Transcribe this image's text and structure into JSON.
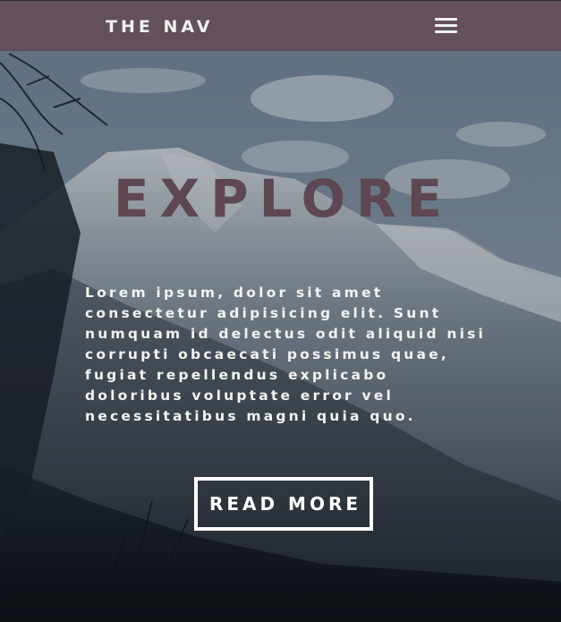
{
  "nav": {
    "brand": "THE NAV",
    "menu_icon": "hamburger-menu-icon",
    "background_color": "#64505a"
  },
  "hero": {
    "title": "EXPLORE",
    "title_color": "#5e4753",
    "body": "Lorem ipsum, dolor sit amet consectetur adipisicing elit. Sunt numquam id delectus odit aliquid nisi corrupti obcaecati possimus quae, fugiat repellendus explicabo doloribus voluptate error vel necessitatibus magni quia quo.",
    "cta_label": "READ MORE"
  }
}
